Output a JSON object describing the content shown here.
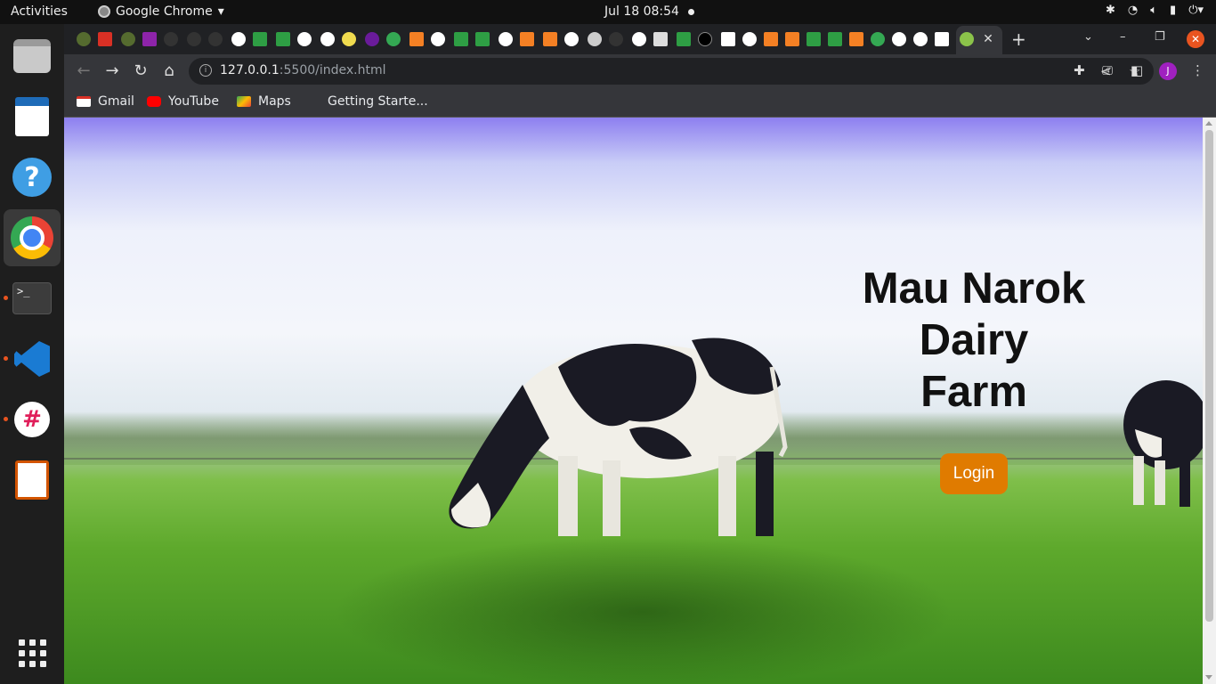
{
  "system": {
    "activities_label": "Activities",
    "app_name": "Google Chrome",
    "clock": "Jul 18  08:54"
  },
  "dock": {
    "items": [
      "files-icon",
      "document-viewer-icon",
      "help-icon",
      "chrome-icon",
      "terminal-icon",
      "vscode-icon",
      "slack-icon",
      "impress-icon",
      "show-apps-icon"
    ],
    "terminal_prompt": ">_"
  },
  "browser": {
    "url_host": "127.0.0.1",
    "url_path": ":5500/index.html",
    "profile_initial": "J",
    "bookmarks": [
      {
        "label": "Gmail",
        "icon": "gmail-icon"
      },
      {
        "label": "YouTube",
        "icon": "youtube-icon"
      },
      {
        "label": "Maps",
        "icon": "maps-icon"
      },
      {
        "label": "Getting Starte...",
        "icon": "bookmark-icon"
      }
    ]
  },
  "page": {
    "title_line1": "Mau Narok",
    "title_line2": "Dairy",
    "title_line3": "Farm",
    "login_label": "Login"
  },
  "colors": {
    "accent_orange": "#e07b00",
    "ubuntu_orange": "#e95420",
    "title_text": "#111111"
  }
}
